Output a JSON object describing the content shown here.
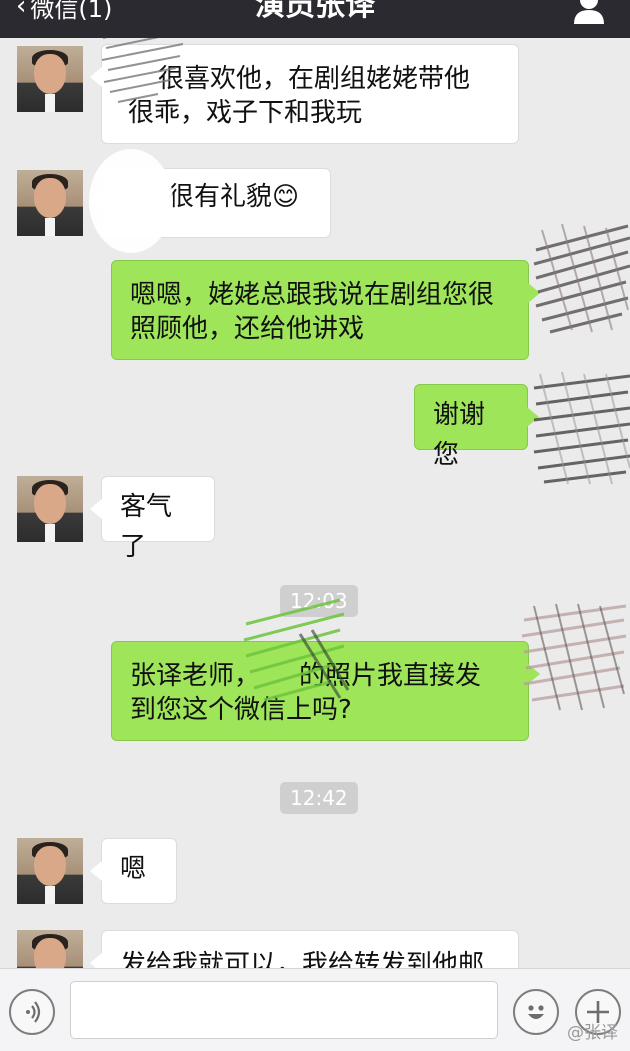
{
  "header": {
    "back_label": "微信(1)",
    "title": "演员张译"
  },
  "messages": [
    {
      "side": "left",
      "lines": [
        "很喜欢他，在剧组姥姥带他",
        "很乖，戏子下和我玩"
      ]
    },
    {
      "side": "left",
      "lines": [
        "很有礼貌😊"
      ]
    },
    {
      "side": "right",
      "lines": [
        "嗯嗯，姥姥总跟我说在剧组您很",
        "照顾他，还给他讲戏"
      ]
    },
    {
      "side": "right",
      "lines": [
        "谢谢您"
      ]
    },
    {
      "side": "left",
      "lines": [
        "客气了"
      ]
    },
    {
      "side": "time",
      "text": "12:03"
    },
    {
      "side": "right",
      "lines": [
        "张译老师，　　的照片我直接发",
        "到您这个微信上吗?"
      ]
    },
    {
      "side": "time",
      "text": "12:42"
    },
    {
      "side": "left",
      "lines": [
        "嗯"
      ]
    },
    {
      "side": "left",
      "lines": [
        "发给我就可以，我给转发到他邮"
      ]
    }
  ],
  "input_bar": {
    "placeholder": "",
    "icons": [
      "voice-icon",
      "emoji-icon",
      "plus-icon"
    ]
  },
  "watermark": "@张译",
  "colors": {
    "header_bg": "#2a2a30",
    "chat_bg": "#ebebeb",
    "sent_bubble": "#9ee559",
    "received_bubble": "#ffffff"
  }
}
